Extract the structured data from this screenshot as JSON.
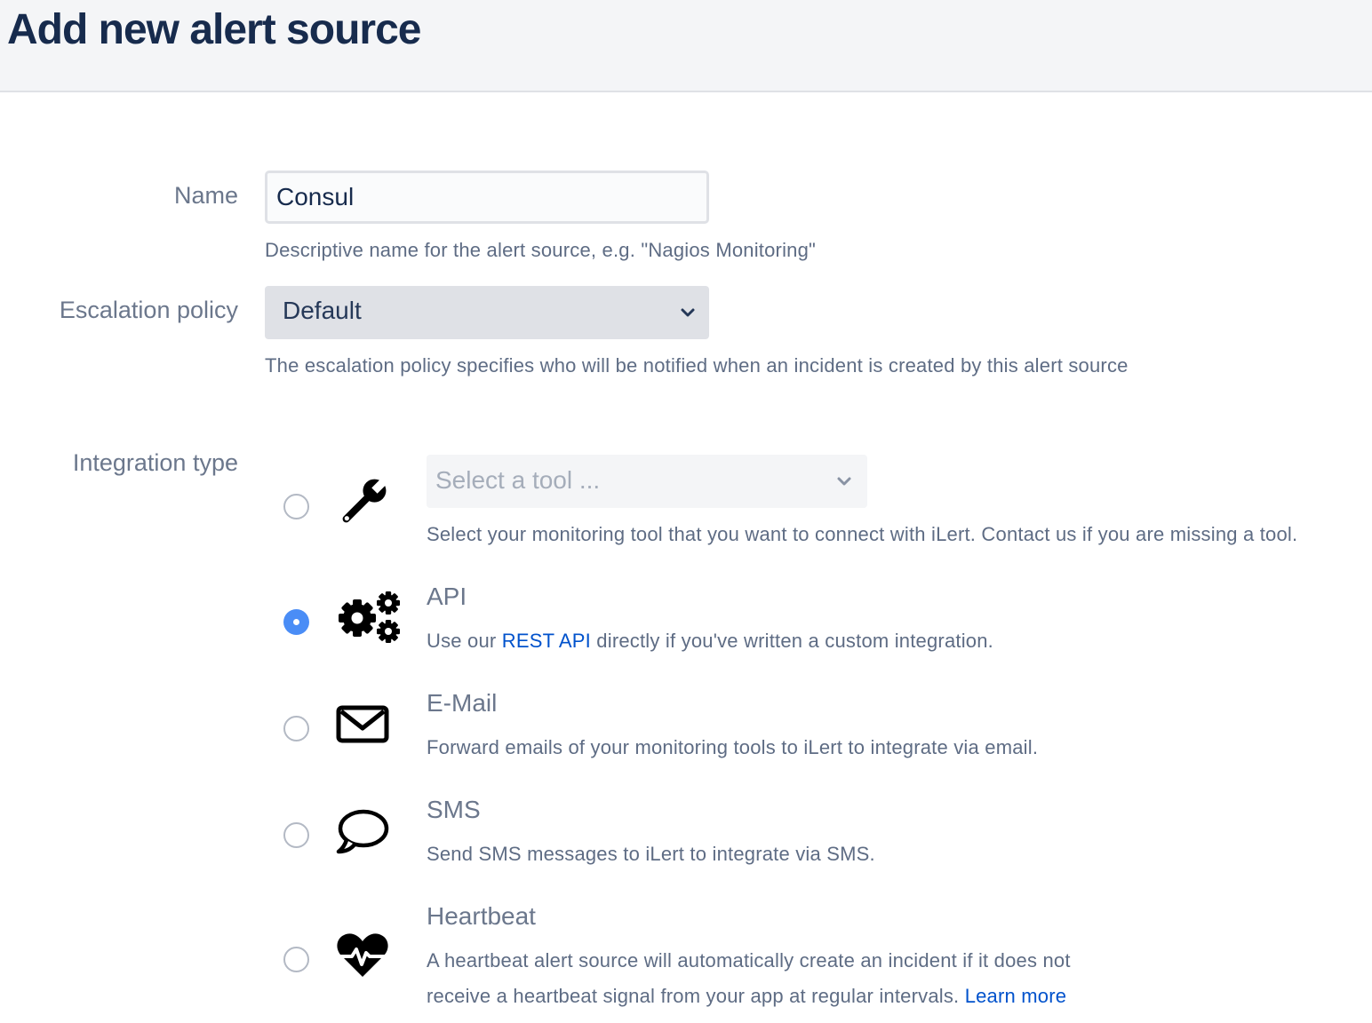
{
  "header": {
    "title": "Add new alert source"
  },
  "form": {
    "name": {
      "label": "Name",
      "value": "Consul",
      "help": "Descriptive name for the alert source, e.g. \"Nagios Monitoring\""
    },
    "escalation_policy": {
      "label": "Escalation policy",
      "selected": "Default",
      "help": "The escalation policy specifies who will be notified when an incident is created by this alert source"
    },
    "integration_type": {
      "label": "Integration type",
      "selected": "API",
      "options": [
        {
          "id": "tool",
          "icon": "wrench-icon",
          "placeholder": "Select a tool ...",
          "description": "Select your monitoring tool that you want to connect with iLert. Contact us if you are missing a tool."
        },
        {
          "id": "api",
          "icon": "gears-icon",
          "title": "API",
          "desc_before": "Use our ",
          "desc_link": "REST API",
          "desc_after": " directly if you've written a custom integration."
        },
        {
          "id": "email",
          "icon": "envelope-icon",
          "title": "E-Mail",
          "description": "Forward emails of your monitoring tools to iLert to integrate via email."
        },
        {
          "id": "sms",
          "icon": "speech-bubble-icon",
          "title": "SMS",
          "description": "Send SMS messages to iLert to integrate via SMS."
        },
        {
          "id": "heartbeat",
          "icon": "heartbeat-icon",
          "title": "Heartbeat",
          "desc_line1": "A heartbeat alert source will automatically create an incident if it does not",
          "desc_line2_before": "receive a heartbeat signal from your app at regular intervals. ",
          "desc_line2_link": "Learn more"
        }
      ]
    }
  },
  "colors": {
    "title": "#172b4d",
    "label": "#6b778c",
    "help": "#5e6c84",
    "link": "#0052cc",
    "radio_checked": "#4a8df6",
    "header_bg": "#f4f5f7"
  }
}
